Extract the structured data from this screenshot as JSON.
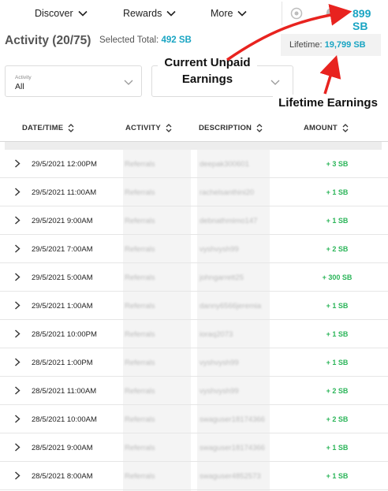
{
  "nav": {
    "items": [
      {
        "label": "Discover"
      },
      {
        "label": "Rewards"
      },
      {
        "label": "More"
      }
    ],
    "balance": "899 SB",
    "icons": [
      "gift-icon",
      "bell-icon"
    ]
  },
  "header": {
    "title": "Activity (20/75)",
    "selected_total_label": "Selected Total:",
    "selected_total_value": "492 SB",
    "lifetime_label": "Lifetime:",
    "lifetime_value": "19,799 SB"
  },
  "filters": {
    "activity": {
      "label": "Activity",
      "value": "All"
    }
  },
  "annotations": {
    "unpaid": "Current Unpaid Earnings",
    "lifetime": "Lifetime Earnings"
  },
  "colors": {
    "accent": "#1aa5c3",
    "positive": "#2bb559",
    "arrow": "#e8231f"
  },
  "table": {
    "columns": [
      "DATE/TIME",
      "ACTIVITY",
      "DESCRIPTION",
      "AMOUNT"
    ],
    "rows": [
      {
        "date": "29/5/2021 12:00PM",
        "activity": "Referrals",
        "description": "deepak300601",
        "amount": "+ 3 SB"
      },
      {
        "date": "29/5/2021 11:00AM",
        "activity": "Referrals",
        "description": "rachelsanthini20",
        "amount": "+ 1 SB"
      },
      {
        "date": "29/5/2021 9:00AM",
        "activity": "Referrals",
        "description": "debnathmimo147",
        "amount": "+ 1 SB"
      },
      {
        "date": "29/5/2021 7:00AM",
        "activity": "Referrals",
        "description": "vyshvysh99",
        "amount": "+ 2 SB"
      },
      {
        "date": "29/5/2021 5:00AM",
        "activity": "Referrals",
        "description": "johngarrett25",
        "amount": "+ 300 SB"
      },
      {
        "date": "29/5/2021 1:00AM",
        "activity": "Referrals",
        "description": "danny6566jeremia",
        "amount": "+ 1 SB"
      },
      {
        "date": "28/5/2021 10:00PM",
        "activity": "Referrals",
        "description": "ioraq2073",
        "amount": "+ 1 SB"
      },
      {
        "date": "28/5/2021 1:00PM",
        "activity": "Referrals",
        "description": "vyshvysh99",
        "amount": "+ 1 SB"
      },
      {
        "date": "28/5/2021 11:00AM",
        "activity": "Referrals",
        "description": "vyshvysh99",
        "amount": "+ 2 SB"
      },
      {
        "date": "28/5/2021 10:00AM",
        "activity": "Referrals",
        "description": "swaguser18174366",
        "amount": "+ 2 SB"
      },
      {
        "date": "28/5/2021 9:00AM",
        "activity": "Referrals",
        "description": "swaguser18174366",
        "amount": "+ 1 SB"
      },
      {
        "date": "28/5/2021 8:00AM",
        "activity": "Referrals",
        "description": "swaguser4852573",
        "amount": "+ 1 SB"
      }
    ]
  }
}
